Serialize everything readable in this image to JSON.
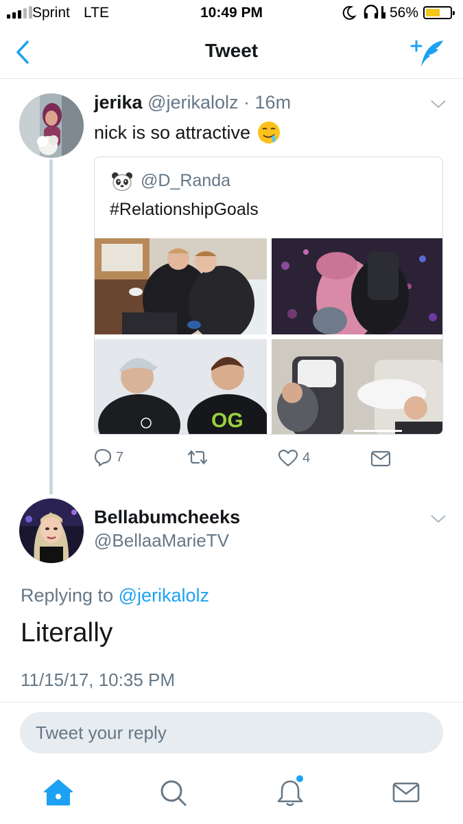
{
  "status_bar": {
    "carrier": "Sprint",
    "network": "LTE",
    "time": "10:49 PM",
    "battery": "56%",
    "battery_level": 0.56
  },
  "nav": {
    "title": "Tweet"
  },
  "tweet": {
    "name": "jerika",
    "handle": "@jerikalolz",
    "age": "· 16m",
    "text": "nick is so attractive",
    "quoted": {
      "handle": "@D_Randa",
      "text": "#RelationshipGoals"
    },
    "reply_count": "7",
    "like_count": "4"
  },
  "reply": {
    "name": "Bellabumcheeks",
    "handle": "@BellaaMarieTV",
    "replying_prefix": "Replying to",
    "replying_handle": "@jerikalolz",
    "text": "Literally",
    "timestamp": "11/15/17, 10:35 PM"
  },
  "composer": {
    "placeholder": "Tweet your reply"
  },
  "colors": {
    "accent": "#1da1f2",
    "muted": "#657786",
    "text": "#14171a"
  },
  "icons": [
    "back-icon",
    "compose-icon",
    "reply-icon",
    "retweet-icon",
    "like-icon",
    "dm-icon",
    "home-icon",
    "search-icon",
    "notifications-icon",
    "messages-icon"
  ]
}
